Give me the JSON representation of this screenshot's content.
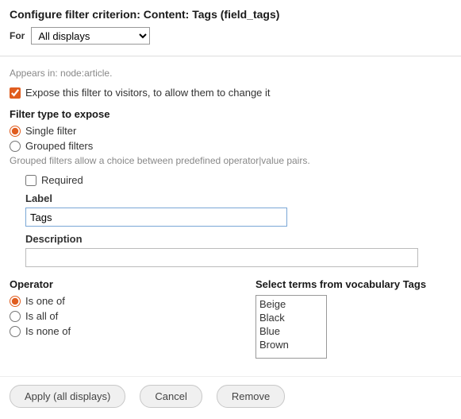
{
  "title": "Configure filter criterion: Content: Tags (field_tags)",
  "for_label": "For",
  "for_value": "All displays",
  "appears_in": "Appears in: node:article.",
  "expose": {
    "checked": true,
    "label": "Expose this filter to visitors, to allow them to change it"
  },
  "filter_type": {
    "heading": "Filter type to expose",
    "options": [
      {
        "label": "Single filter",
        "checked": true
      },
      {
        "label": "Grouped filters",
        "checked": false
      }
    ],
    "hint": "Grouped filters allow a choice between predefined operator|value pairs."
  },
  "required": {
    "checked": false,
    "label": "Required"
  },
  "label_field": {
    "heading": "Label",
    "value": "Tags"
  },
  "description_field": {
    "heading": "Description",
    "value": ""
  },
  "operator": {
    "heading": "Operator",
    "options": [
      {
        "label": "Is one of",
        "checked": true
      },
      {
        "label": "Is all of",
        "checked": false
      },
      {
        "label": "Is none of",
        "checked": false
      }
    ]
  },
  "terms": {
    "heading": "Select terms from vocabulary Tags",
    "options": [
      "Beige",
      "Black",
      "Blue",
      "Brown"
    ]
  },
  "buttons": {
    "apply": "Apply (all displays)",
    "cancel": "Cancel",
    "remove": "Remove"
  }
}
